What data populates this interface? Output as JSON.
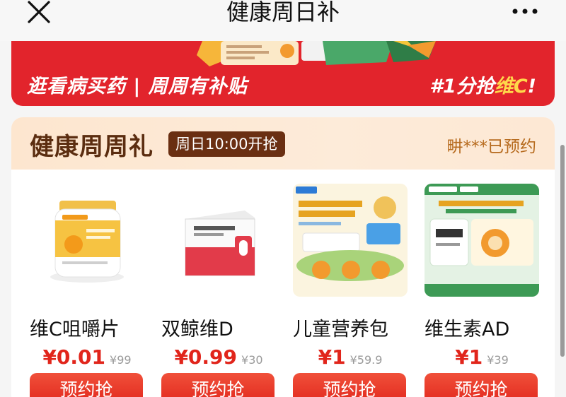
{
  "header": {
    "title": "健康周日补",
    "close_icon": "close-icon",
    "more_icon": "more-options-icon"
  },
  "banner": {
    "slogan": "逛看病买药 | 周周有补贴",
    "promo_prefix": "#1分抢",
    "promo_highlight": "维C",
    "promo_suffix": "!",
    "colors": {
      "background": "#e2242c",
      "highlight": "#ffd84a"
    }
  },
  "weekly_gift": {
    "title": "健康周周礼",
    "time_badge": "周日10:00开抢",
    "reserved_text": "畊***已预约",
    "products": [
      {
        "name": "维C咀嚼片",
        "price": "¥0.01",
        "original_price": "¥99",
        "button": "预约抢"
      },
      {
        "name": "双鲸维D",
        "price": "¥0.99",
        "original_price": "¥30",
        "button": "预约抢"
      },
      {
        "name": "儿童营养包",
        "price": "¥1",
        "original_price": "¥59.9",
        "button": "预约抢"
      },
      {
        "name": "维生素AD",
        "price": "¥1",
        "original_price": "¥39",
        "button": "预约抢"
      }
    ],
    "colors": {
      "price": "#e1251b",
      "button": "#e1251b",
      "title": "#5b2d10"
    }
  }
}
